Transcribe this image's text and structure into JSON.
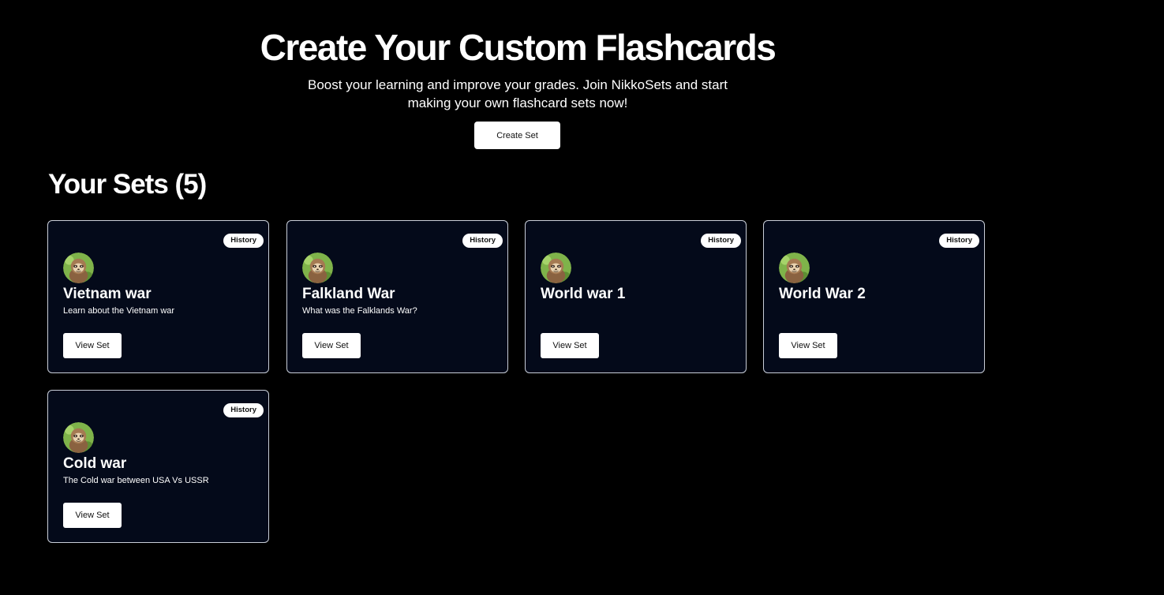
{
  "hero": {
    "title": "Create Your Custom Flashcards",
    "subtitle": "Boost your learning and improve your grades. Join NikkoSets and start making your own flashcard sets now!",
    "create_button_label": "Create Set"
  },
  "sets_section": {
    "heading": "Your Sets (5)"
  },
  "sets": [
    {
      "tag": "History",
      "title": "Vietnam war",
      "description": "Learn about the Vietnam war",
      "button_label": "View Set",
      "avatar_icon": "sloth-avatar-icon"
    },
    {
      "tag": "History",
      "title": "Falkland War",
      "description": "What was the Falklands War?",
      "button_label": "View Set",
      "avatar_icon": "sloth-avatar-icon"
    },
    {
      "tag": "History",
      "title": "World war 1",
      "description": "",
      "button_label": "View Set",
      "avatar_icon": "sloth-avatar-icon"
    },
    {
      "tag": "History",
      "title": "World War 2",
      "description": "",
      "button_label": "View Set",
      "avatar_icon": "sloth-avatar-icon"
    },
    {
      "tag": "History",
      "title": "Cold war",
      "description": "The Cold war between USA Vs USSR",
      "button_label": "View Set",
      "avatar_icon": "sloth-avatar-icon"
    }
  ],
  "colors": {
    "background": "#000000",
    "card_background": "#040a1a",
    "card_border": "#c9ced8",
    "button_background": "#ffffff",
    "avatar_background": "#7fb34a"
  }
}
